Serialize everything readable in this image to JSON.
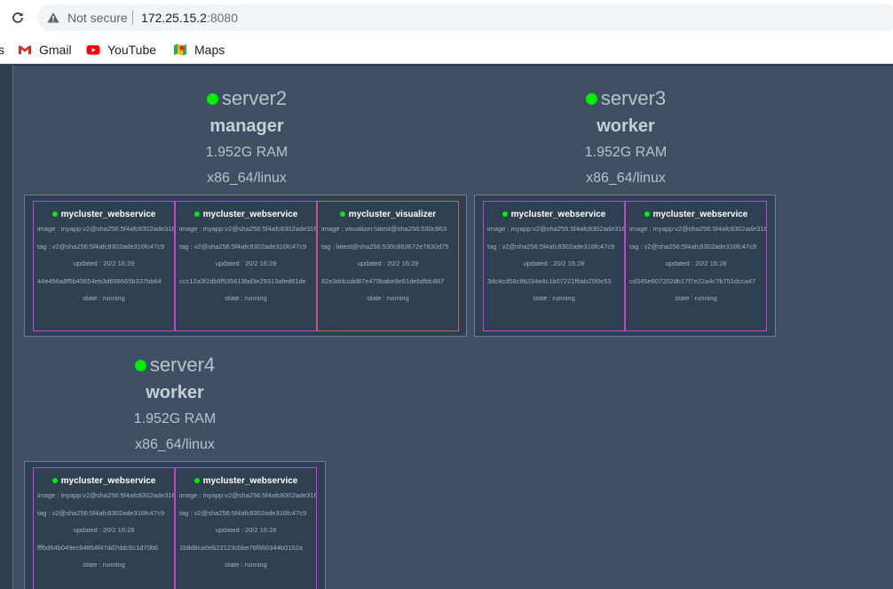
{
  "browser": {
    "not_secure": "Not secure",
    "url_host": "172.25.15.2",
    "url_port": ":8080",
    "bookmarks": [
      {
        "label": "s"
      },
      {
        "label": "Gmail"
      },
      {
        "label": "YouTube"
      },
      {
        "label": "Maps"
      }
    ]
  },
  "nodes": [
    {
      "name": "server2",
      "role": "manager",
      "ram": "1.952G RAM",
      "arch": "x86_64/linux",
      "tasks": [
        {
          "name": "mycluster_webservice",
          "image": "image : myapp:v2@sha256:5f4afc8302ade316fc47c9",
          "tag": "tag : v2@sha256:5f4afc8302ade316fc47c9",
          "updated": "updated : 20/2 16:29",
          "id": "44e456a8f5b45654eb3d699665b337bb64",
          "state": "state : running"
        },
        {
          "name": "mycluster_webservice",
          "image": "image : myapp:v2@sha256:5f4afc8302ade316fc47c9",
          "tag": "tag : v2@sha256:5f4afc8302ade316fc47c9",
          "updated": "updated : 20/2 16:29",
          "id": "ccc12a3f2db9f535619bd3e29313afed81de",
          "state": "state : running"
        },
        {
          "name": "mycluster_visualizer",
          "image": "image : visualizer:latest@sha256:530c863",
          "tag": "tag : latest@sha256:530c863672e7830d75",
          "updated": "updated : 20/2 16:29",
          "id": "82e3ddccdd87e479babe8e81debdfdc867",
          "state": "state : running"
        }
      ]
    },
    {
      "name": "server3",
      "role": "worker",
      "ram": "1.952G RAM",
      "arch": "x86_64/linux",
      "tasks": [
        {
          "name": "mycluster_webservice",
          "image": "image : myapp:v2@sha256:5f4afc8302ade316fc47c9",
          "tag": "tag : v2@sha256:5f4afc8302ade316fc47c9",
          "updated": "updated : 20/2 16:28",
          "id": "3dc4cd58c8b234e8c1b07221f6ab25f0c63",
          "state": "state : running"
        },
        {
          "name": "mycluster_webservice",
          "image": "image : myapp:v2@sha256:5f4afc8302ade316fc47c9",
          "tag": "tag : v2@sha256:5f4afc8302ade316fc47c9",
          "updated": "updated : 20/2 16:28",
          "id": "cd345e807202db17f7e22a4c7b751dcca47",
          "state": "state : running"
        }
      ]
    },
    {
      "name": "server4",
      "role": "worker",
      "ram": "1.952G RAM",
      "arch": "x86_64/linux",
      "tasks": [
        {
          "name": "mycluster_webservice",
          "image": "image : myapp:v2@sha256:5f4afc8302ade316fc47c9",
          "tag": "tag : v2@sha256:5f4afc8302ade316fc47c9",
          "updated": "updated : 20/2 16:28",
          "id": "fffbd64b049ec64854f47dd7ddc6c1d70b6",
          "state": "state : running"
        },
        {
          "name": "mycluster_webservice",
          "image": "image : myapp:v2@sha256:5f4afc8302ade316fc47c9",
          "tag": "tag : v2@sha256:5f4afc8302ade316fc47c9",
          "updated": "updated : 20/2 16:28",
          "id": "1b8d8ca0eb22123cbbe76f660344b0152a",
          "state": "state : running"
        }
      ]
    }
  ]
}
